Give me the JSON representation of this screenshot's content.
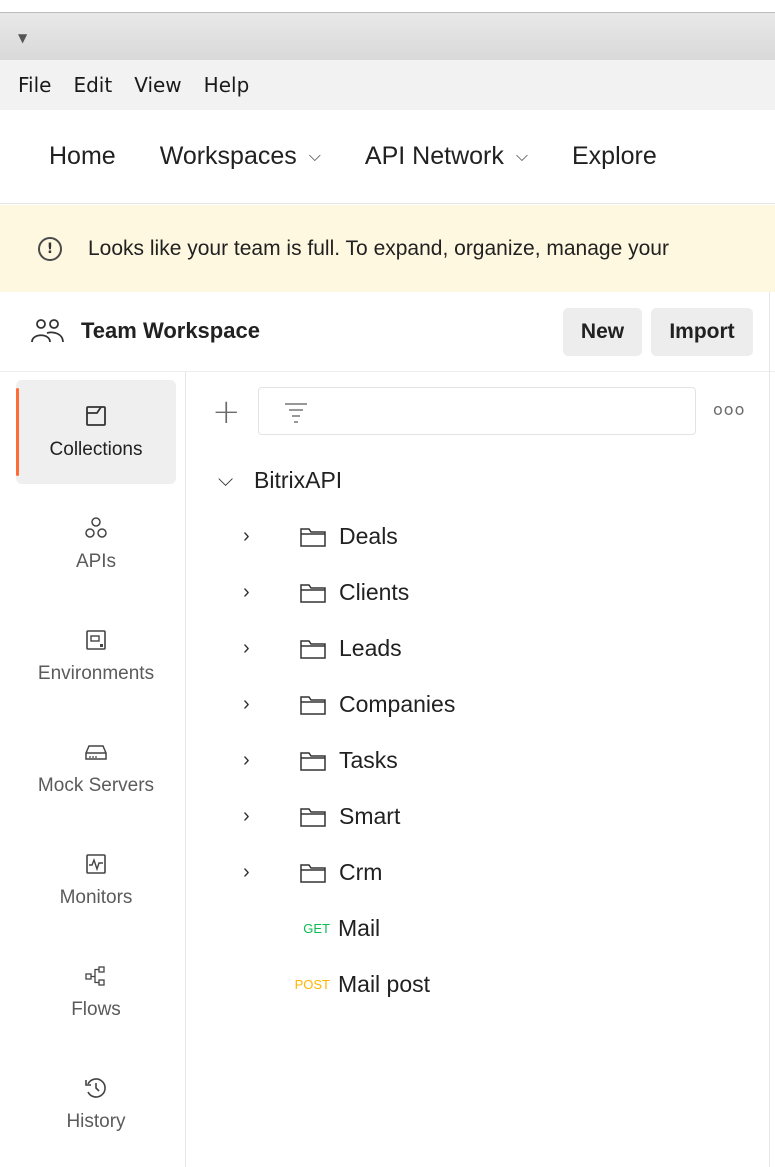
{
  "menu": [
    "File",
    "Edit",
    "View",
    "Help"
  ],
  "nav": {
    "home": "Home",
    "workspaces": "Workspaces",
    "api_network": "API Network",
    "explore": "Explore"
  },
  "banner": {
    "text": "Looks like your team is full. To expand, organize, manage your"
  },
  "workspace": {
    "title": "Team Workspace",
    "new_label": "New",
    "import_label": "Import"
  },
  "rail": {
    "collections": "Collections",
    "apis": "APIs",
    "environments": "Environments",
    "mock_servers": "Mock Servers",
    "monitors": "Monitors",
    "flows": "Flows",
    "history": "History"
  },
  "tree": {
    "root": "BitrixAPI",
    "folders": [
      "Deals",
      "Clients",
      "Leads",
      "Companies",
      "Tasks",
      "Smart",
      "Crm"
    ],
    "requests": [
      {
        "method": "GET",
        "name": "Mail"
      },
      {
        "method": "POST",
        "name": "Mail post"
      }
    ]
  },
  "colors": {
    "accent": "#ff6c37",
    "banner_bg": "#fff8e1",
    "get": "#0cbb52",
    "post": "#ffb400"
  }
}
